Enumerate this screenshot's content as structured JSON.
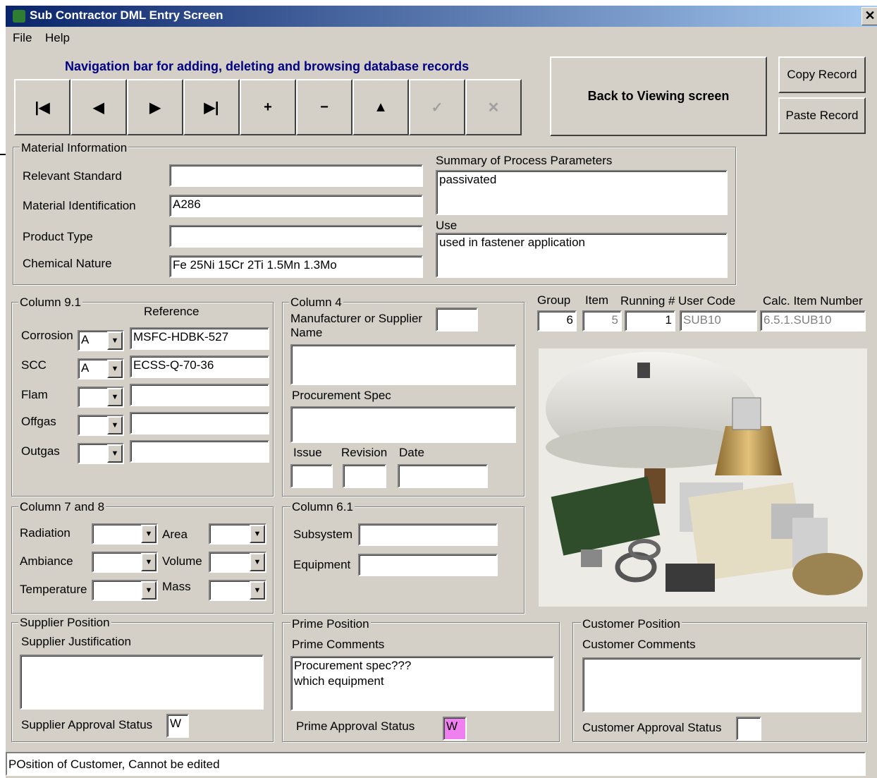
{
  "window": {
    "title": "Sub Contractor DML Entry Screen",
    "close_glyph": "✕"
  },
  "menu": {
    "file": "File",
    "help": "Help"
  },
  "nav": {
    "caption": "Navigation bar for adding, deleting and browsing database records",
    "buttons": [
      {
        "name": "first-record-button",
        "glyph": "|◀",
        "enabled": true
      },
      {
        "name": "previous-record-button",
        "glyph": "◀",
        "enabled": true
      },
      {
        "name": "next-record-button",
        "glyph": "▶",
        "enabled": true
      },
      {
        "name": "last-record-button",
        "glyph": "▶|",
        "enabled": true
      },
      {
        "name": "add-record-button",
        "glyph": "+",
        "enabled": true
      },
      {
        "name": "delete-record-button",
        "glyph": "−",
        "enabled": true
      },
      {
        "name": "edit-record-button",
        "glyph": "▲",
        "enabled": true
      },
      {
        "name": "post-edit-button",
        "glyph": "✓",
        "enabled": false
      },
      {
        "name": "cancel-edit-button",
        "glyph": "✕",
        "enabled": false
      }
    ]
  },
  "actions": {
    "back": "Back to Viewing screen",
    "copy": "Copy Record",
    "paste": "Paste Record"
  },
  "material": {
    "group_label": "Material Information",
    "relevant_standard_label": "Relevant Standard",
    "relevant_standard": "",
    "material_identification_label": "Material Identification",
    "material_identification": "A286",
    "product_type_label": "Product Type",
    "product_type": "",
    "chemical_nature_label": "Chemical Nature",
    "chemical_nature": "Fe 25Ni 15Cr 2Ti 1.5Mn 1.3Mo",
    "summary_label": "Summary of Process Parameters",
    "summary": "passivated",
    "use_label": "Use",
    "use": "used in fastener application"
  },
  "ids": {
    "group_label": "Group",
    "group": "6",
    "item_label": "Item",
    "item": "5",
    "running_label": "Running #",
    "running": "1",
    "user_code_label": "User Code",
    "user_code": "SUB10",
    "calc_label": "Calc. Item Number",
    "calc": "6.5.1.SUB10"
  },
  "col91": {
    "group_label": "Column 9.1",
    "reference_label": "Reference",
    "rows": [
      {
        "label": "Corrosion",
        "code": "A",
        "ref": "MSFC-HDBK-527"
      },
      {
        "label": "SCC",
        "code": "A",
        "ref": "ECSS-Q-70-36"
      },
      {
        "label": "Flam",
        "code": "",
        "ref": ""
      },
      {
        "label": "Offgas",
        "code": "",
        "ref": ""
      },
      {
        "label": "Outgas",
        "code": "",
        "ref": ""
      }
    ]
  },
  "col4": {
    "group_label": "Column 4",
    "manufacturer_label": "Manufacturer or Supplier Name",
    "manufacturer_code": "",
    "manufacturer": "",
    "procurement_label": "Procurement Spec",
    "procurement": "",
    "issue_label": "Issue",
    "issue": "",
    "revision_label": "Revision",
    "revision": "",
    "date_label": "Date",
    "date": ""
  },
  "col78": {
    "group_label": "Column 7 and 8",
    "radiation_label": "Radiation",
    "radiation": "",
    "ambiance_label": "Ambiance",
    "ambiance": "",
    "temperature_label": "Temperature",
    "temperature": "",
    "area_label": "Area",
    "area": "",
    "volume_label": "Volume",
    "volume": "",
    "mass_label": "Mass",
    "mass": ""
  },
  "col61": {
    "group_label": "Column 6.1",
    "subsystem_label": "Subsystem",
    "subsystem": "",
    "equipment_label": "Equipment",
    "equipment": ""
  },
  "supplier": {
    "group_label": "Supplier Position",
    "justification_label": "Supplier Justification",
    "justification": "",
    "status_label": "Supplier Approval Status",
    "status": "W"
  },
  "prime": {
    "group_label": "Prime Position",
    "comments_label": "Prime Comments",
    "comments": "Procurement spec???\nwhich equipment",
    "status_label": "Prime Approval Status",
    "status": "W"
  },
  "customer": {
    "group_label": "Customer Position",
    "comments_label": "Customer Comments",
    "comments": "",
    "status_label": "Customer Approval Status",
    "status": ""
  },
  "statusbar": {
    "text": "POsition of Customer, Cannot be edited"
  }
}
